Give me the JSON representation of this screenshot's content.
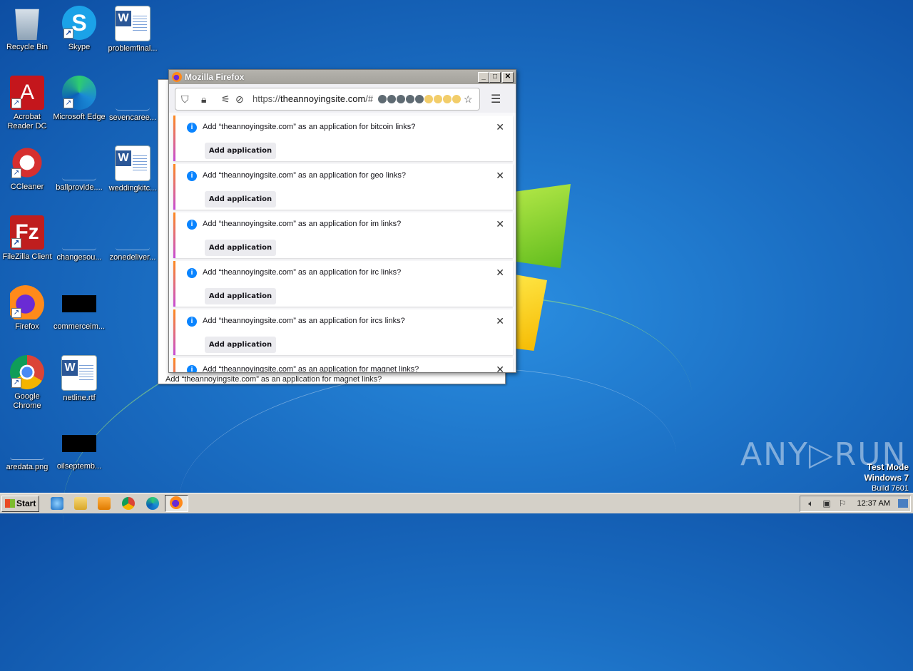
{
  "desktop": {
    "icons": [
      {
        "label": "Recycle Bin",
        "icon": "recycle-bin-icon"
      },
      {
        "label": "Skype",
        "icon": "skype-icon"
      },
      {
        "label": "problemfinal...",
        "icon": "word-doc-icon"
      },
      {
        "label": "Acrobat Reader DC",
        "icon": "acrobat-icon"
      },
      {
        "label": "Microsoft Edge",
        "icon": "edge-icon"
      },
      {
        "label": "sevencaree...",
        "icon": "file-icon"
      },
      {
        "label": "CCleaner",
        "icon": "ccleaner-icon"
      },
      {
        "label": "ballprovide....",
        "icon": "file-icon"
      },
      {
        "label": "weddingkitc...",
        "icon": "word-doc-icon"
      },
      {
        "label": "FileZilla Client",
        "icon": "filezilla-icon"
      },
      {
        "label": "changesou...",
        "icon": "file-icon"
      },
      {
        "label": "zonedeliver...",
        "icon": "file-icon"
      },
      {
        "label": "Firefox",
        "icon": "firefox-icon"
      },
      {
        "label": "commerceim...",
        "icon": "image-thumbnail-icon"
      },
      {
        "label": "Google Chrome",
        "icon": "chrome-icon"
      },
      {
        "label": "netline.rtf",
        "icon": "word-doc-icon"
      },
      {
        "label": "aredata.png",
        "icon": "file-icon"
      },
      {
        "label": "oilseptemb...",
        "icon": "image-thumbnail-icon"
      }
    ]
  },
  "firefox": {
    "title": "Mozilla Firefox",
    "url_prefix": "https://",
    "url_host": "theannoyingsite.com",
    "url_suffix": "/#",
    "dot_colors": [
      "#5f6b73",
      "#5f6b73",
      "#5f6b73",
      "#5f6b73",
      "#5f6b73",
      "#f2cd6a",
      "#f2cd6a",
      "#f2cd6a",
      "#f2cd6a"
    ],
    "add_button_label": "Add application",
    "notifications": [
      {
        "text": "Add “theannoyingsite.com” as an application for bitcoin links?"
      },
      {
        "text": "Add “theannoyingsite.com” as an application for geo links?"
      },
      {
        "text": "Add “theannoyingsite.com” as an application for im links?"
      },
      {
        "text": "Add “theannoyingsite.com” as an application for irc links?"
      },
      {
        "text": "Add “theannoyingsite.com” as an application for ircs links?"
      },
      {
        "text": "Add “theannoyingsite.com” as an application for magnet links?"
      }
    ]
  },
  "back_window": {
    "partial_notification": "Add “theannoyingsite.com” as an application for magnet links?"
  },
  "taskbar": {
    "start_label": "Start",
    "clock": "12:37 AM"
  },
  "watermark": {
    "text": "ANY▷RUN",
    "test_mode": "Test Mode",
    "os": "Windows 7",
    "build": "Build 7601"
  }
}
